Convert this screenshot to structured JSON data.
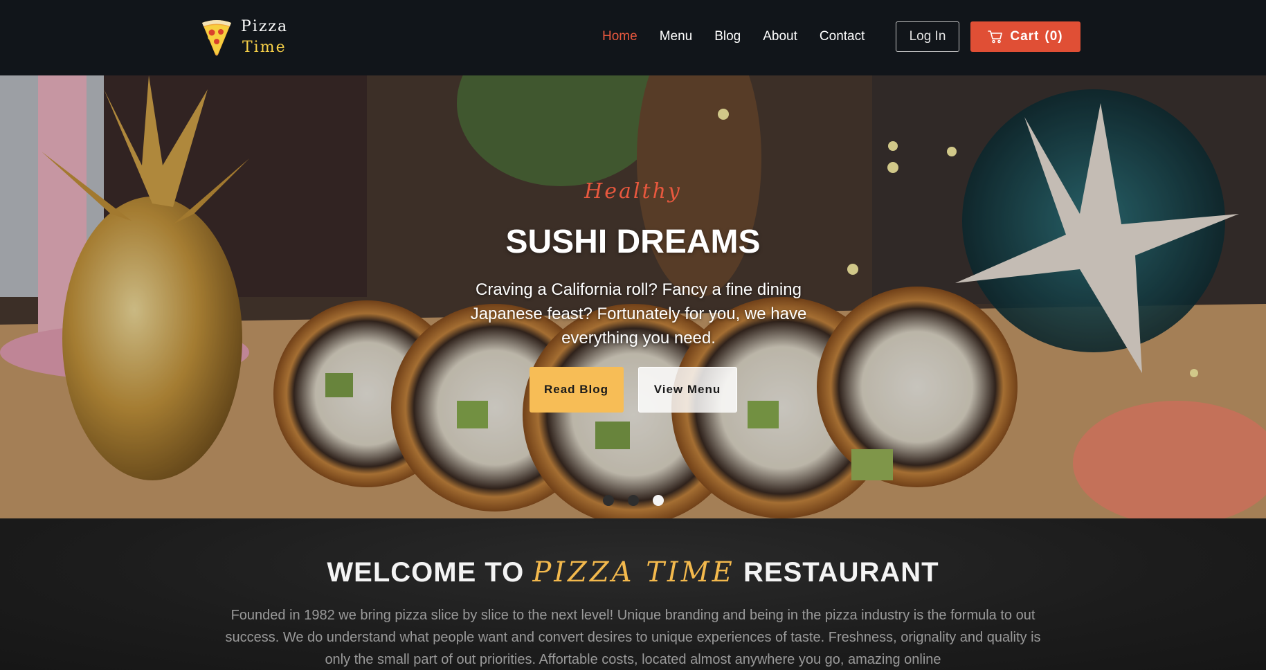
{
  "brand": {
    "line1": "Pizza",
    "line2": "Time",
    "logo_icon": "pizza-slice-icon",
    "accent_color": "#f7d048"
  },
  "nav": {
    "items": [
      {
        "label": "Home",
        "active": true
      },
      {
        "label": "Menu",
        "active": false
      },
      {
        "label": "Blog",
        "active": false
      },
      {
        "label": "About",
        "active": false
      },
      {
        "label": "Contact",
        "active": false
      }
    ],
    "active_color": "#e8583e",
    "login_label": "Log In",
    "cart_label": "Cart",
    "cart_count": "(0)",
    "cart_icon": "shopping-cart-icon",
    "cart_color": "#e04f35"
  },
  "hero": {
    "kicker": "Healthy",
    "title": "SUSHI DREAMS",
    "description": "Craving a California roll? Fancy a fine dining Japanese feast? Fortunately for you, we have everything you need.",
    "primary_button": "Read Blog",
    "secondary_button": "View Menu",
    "primary_color": "#f7bd56",
    "slides_total": 3,
    "active_slide": 3
  },
  "welcome": {
    "title_prefix": "WELCOME TO",
    "title_accent": "PIZZA TIME",
    "title_suffix": "RESTAURANT",
    "accent_color": "#f3b94d",
    "text": "Founded in 1982 we bring pizza slice by slice to the next level! Unique branding and being in the pizza industry is the formula to out success. We do understand what people want and convert desires to unique experiences of taste. Freshness, orignality and quality is only the small part of out priorities. Affortable costs, located almost anywhere you go, amazing online"
  }
}
